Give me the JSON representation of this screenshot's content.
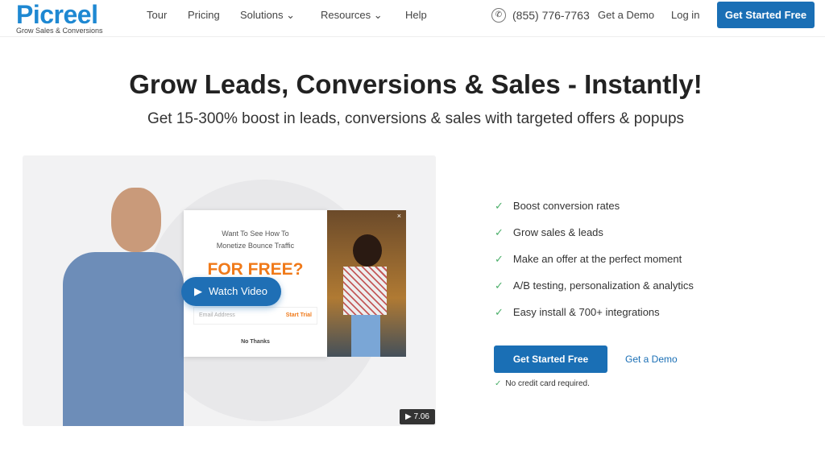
{
  "header": {
    "logo": "Picreel",
    "tagline": "Grow Sales & Conversions",
    "nav": [
      {
        "label": "Tour"
      },
      {
        "label": "Pricing"
      },
      {
        "label": "Solutions",
        "dropdown": true
      },
      {
        "label": "Resources",
        "dropdown": true
      },
      {
        "label": "Help"
      }
    ],
    "phone": "(855) 776-7763",
    "demo": "Get a Demo",
    "login": "Log in",
    "cta": "Get Started Free"
  },
  "hero": {
    "title": "Grow Leads, Conversions & Sales - Instantly!",
    "subtitle": "Get 15-300% boost in leads, conversions & sales with targeted offers & popups"
  },
  "video": {
    "popup_line1": "Want To See How To",
    "popup_line2": "Monetize Bounce Traffic",
    "popup_headline": "FOR FREE?",
    "email_placeholder": "Email Address",
    "start_trial": "Start Trial",
    "no_thanks": "No Thanks",
    "watch": "Watch Video",
    "duration": "7.06"
  },
  "features": [
    "Boost conversion rates",
    "Grow sales & leads",
    "Make an offer at the perfect moment",
    "A/B testing, personalization & analytics",
    "Easy install & 700+ integrations"
  ],
  "cta": {
    "primary": "Get Started Free",
    "secondary": "Get a Demo",
    "note": "No credit card required."
  },
  "colors": {
    "brand": "#1e88d2",
    "button": "#1a6fb5",
    "check": "#4caf6a",
    "orange": "#f07a1a"
  }
}
